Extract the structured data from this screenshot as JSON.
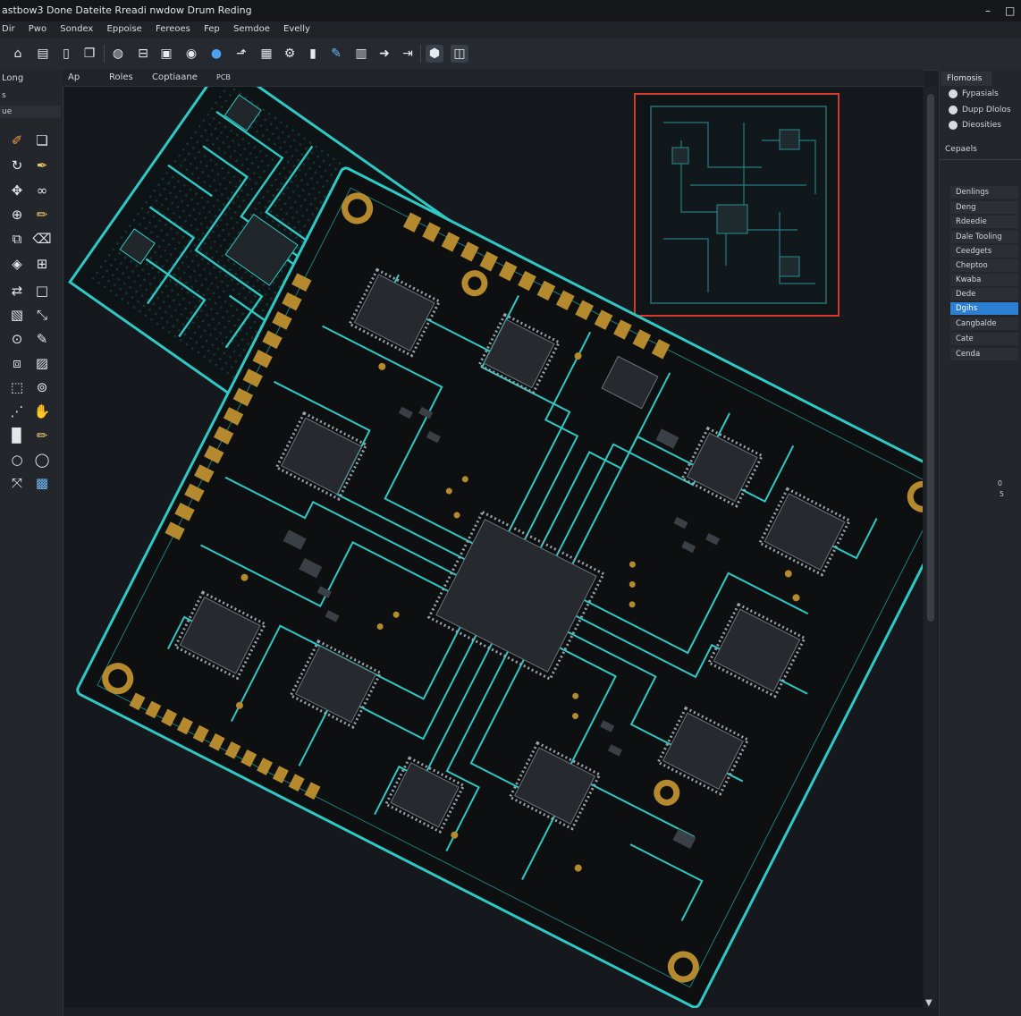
{
  "window": {
    "title": "astbow3 Done  Dateite  Rreadi nwdow Drum  Reding",
    "controls": [
      "–",
      "□"
    ]
  },
  "menu": [
    "Dir",
    "Pwo",
    "Sondex",
    "Eppoise",
    "Fereoes",
    "Fep",
    "Semdoe",
    "Evelly"
  ],
  "toolbar": {
    "icons": [
      "home-icon",
      "document-icon",
      "page-icon",
      "pages-icon",
      "globe-icon",
      "id-card-icon",
      "layout-icon",
      "user-icon",
      "web-globe-icon",
      "route-icon",
      "grid-icon",
      "settings-icon",
      "file-icon",
      "pencil-icon",
      "trash-icon",
      "arrow-right-icon",
      "export-icon",
      "component-icon",
      "layers-icon"
    ]
  },
  "left_panel": {
    "title": "Long",
    "rows": [
      "s",
      "ue"
    ],
    "tools": [
      [
        "edit-icon",
        "window-icon"
      ],
      [
        "rotate-icon",
        "pen-icon"
      ],
      [
        "move-icon",
        "link-icon"
      ],
      [
        "target-icon",
        "ruler-icon"
      ],
      [
        "copy-icon",
        "eraser-icon"
      ],
      [
        "via-icon",
        "bus-icon"
      ],
      [
        "flip-icon",
        "rectangle-icon"
      ],
      [
        "image-icon",
        "resize-icon"
      ],
      [
        "circle-dot-icon",
        "marker-icon"
      ],
      [
        "stack-icon",
        "photo-icon"
      ],
      [
        "frame-icon",
        "zoom-icon"
      ],
      [
        "nodes-icon",
        "pan-icon"
      ],
      [
        "board-icon",
        "pencil-icon"
      ],
      [
        "circle-icon",
        "ring-icon"
      ],
      [
        "connect-icon",
        "library-icon"
      ]
    ]
  },
  "tabs": [
    "Ap",
    "Roles",
    "Coptiaane",
    "PCB"
  ],
  "right_panel": {
    "header": "Flomosis",
    "options": [
      "Fypasials",
      "Dupp Dlolos",
      "Dieosities"
    ],
    "section": "Cepaels",
    "layers": [
      "Denlings",
      "Deng",
      "Rdeedie",
      "Dale Tooling",
      "Ceedgets",
      "Cheptoo",
      "Kwaba",
      "Dede",
      "Dgihs",
      "Cangbalde",
      "Cate",
      "Cenda"
    ],
    "selected_layer": "Dgihs",
    "readouts": [
      "0",
      "5"
    ]
  },
  "colors": {
    "board": "#0d0f11",
    "trace": "#2fc9c5",
    "copper": "#b58a2e",
    "chip": "#262a2f",
    "selection_frame": "#d33b2f",
    "accent": "#2d7fd4"
  }
}
